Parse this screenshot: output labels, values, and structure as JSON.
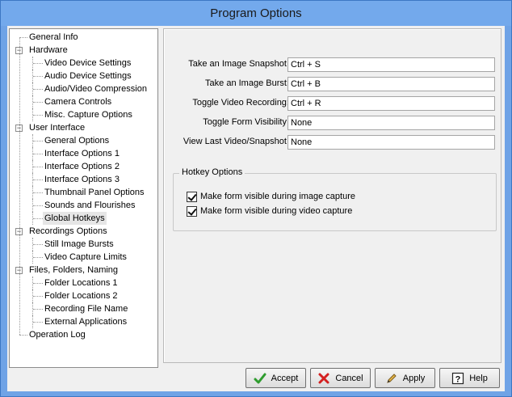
{
  "window": {
    "title": "Program Options"
  },
  "tree": {
    "items": [
      {
        "label": "General Info",
        "level": 0,
        "expander": ""
      },
      {
        "label": "Hardware",
        "level": 0,
        "expander": "−"
      },
      {
        "label": "Video Device Settings",
        "level": 1
      },
      {
        "label": "Audio Device Settings",
        "level": 1
      },
      {
        "label": "Audio/Video Compression",
        "level": 1
      },
      {
        "label": "Camera Controls",
        "level": 1
      },
      {
        "label": "Misc. Capture Options",
        "level": 1
      },
      {
        "label": "User Interface",
        "level": 0,
        "expander": "−"
      },
      {
        "label": "General Options",
        "level": 1
      },
      {
        "label": "Interface Options 1",
        "level": 1
      },
      {
        "label": "Interface Options 2",
        "level": 1
      },
      {
        "label": "Interface Options 3",
        "level": 1
      },
      {
        "label": "Thumbnail Panel Options",
        "level": 1
      },
      {
        "label": "Sounds and Flourishes",
        "level": 1
      },
      {
        "label": "Global Hotkeys",
        "level": 1,
        "selected": true
      },
      {
        "label": "Recordings Options",
        "level": 0,
        "expander": "−"
      },
      {
        "label": "Still Image Bursts",
        "level": 1
      },
      {
        "label": "Video Capture Limits",
        "level": 1
      },
      {
        "label": "Files, Folders, Naming",
        "level": 0,
        "expander": "−"
      },
      {
        "label": "Folder Locations 1",
        "level": 1
      },
      {
        "label": "Folder Locations 2",
        "level": 1
      },
      {
        "label": "Recording File Name",
        "level": 1
      },
      {
        "label": "External Applications",
        "level": 1
      },
      {
        "label": "Operation Log",
        "level": 0,
        "expander": ""
      }
    ]
  },
  "hotkeys": {
    "fields": [
      {
        "label": "Take an Image Snapshot:",
        "value": "Ctrl + S"
      },
      {
        "label": "Take an Image Burst:",
        "value": "Ctrl + B"
      },
      {
        "label": "Toggle Video Recording:",
        "value": "Ctrl + R"
      },
      {
        "label": "Toggle Form Visibility:",
        "value": "None"
      },
      {
        "label": "View Last Video/Snapshot:",
        "value": "None"
      }
    ],
    "group_title": "Hotkey Options",
    "checkboxes": [
      {
        "label": "Make form visible during image capture",
        "checked": true
      },
      {
        "label": "Make form visible during video capture",
        "checked": true
      }
    ]
  },
  "buttons": {
    "accept": "Accept",
    "cancel": "Cancel",
    "apply": "Apply",
    "help": "Help"
  },
  "colors": {
    "title_bar": "#73a9ec",
    "accept_icon": "#2e9c2e",
    "cancel_icon": "#d42020"
  }
}
